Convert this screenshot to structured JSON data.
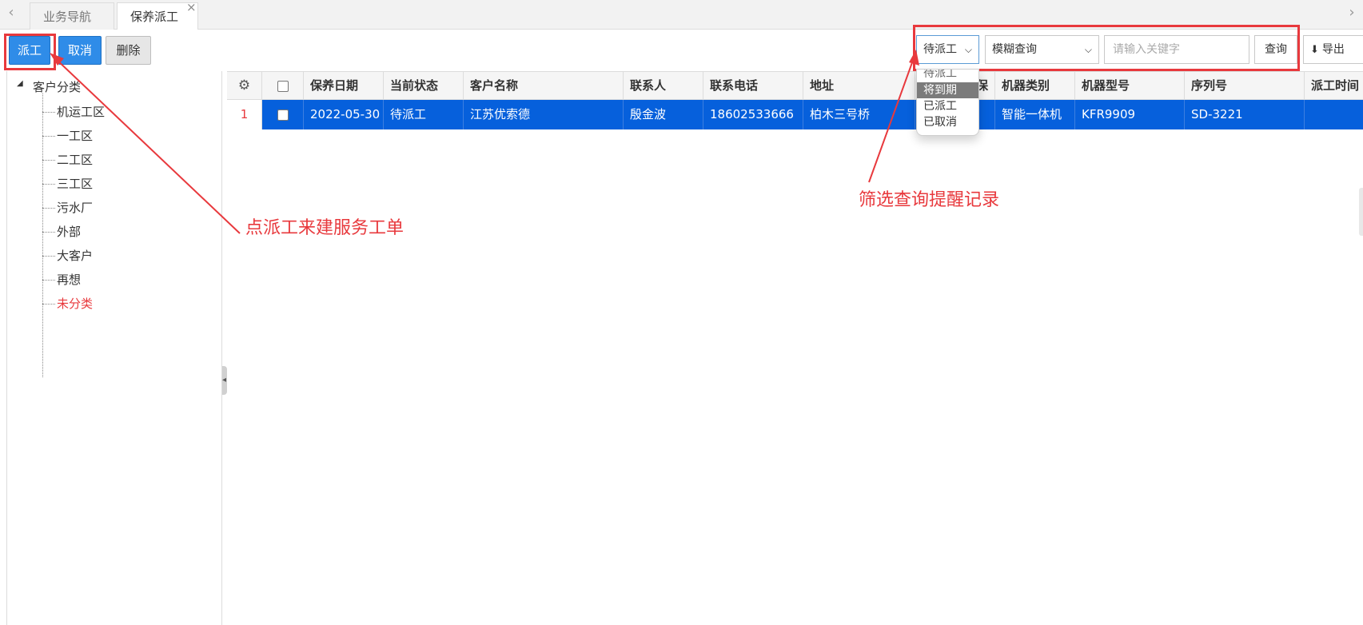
{
  "tabs": {
    "prev_icon": "‹",
    "next_icon": "›",
    "items": [
      {
        "label": "业务导航"
      },
      {
        "label": "保养派工"
      }
    ],
    "close_icon": "×"
  },
  "toolbar": {
    "dispatch_label": "派工",
    "cancel_label": "取消",
    "delete_label": "删除",
    "accent_color": "#2f8ce8"
  },
  "filters": {
    "status_selected": "待派工",
    "status_options": [
      "待派工",
      "将到期",
      "已派工",
      "已取消"
    ],
    "status_highlighted": "将到期",
    "mode_selected": "模糊查询",
    "keyword_placeholder": "请输入关键字",
    "query_label": "查询",
    "export_label": "导出",
    "chevron_icon": "chevron-down-icon",
    "export_icon": "download-icon"
  },
  "sidebar": {
    "root": "客户分类",
    "items": [
      {
        "label": "机运工区"
      },
      {
        "label": "一工区"
      },
      {
        "label": "二工区"
      },
      {
        "label": "三工区"
      },
      {
        "label": "污水厂"
      },
      {
        "label": "外部"
      },
      {
        "label": "大客户"
      },
      {
        "label": "再想"
      },
      {
        "label": "未分类"
      }
    ],
    "highlight_color": "#e8393d"
  },
  "grid": {
    "columns": [
      "保养日期",
      "当前状态",
      "客户名称",
      "联系人",
      "联系电话",
      "地址",
      "保",
      "机器类别",
      "机器型号",
      "序列号",
      "派工时间"
    ],
    "rows": [
      {
        "index": "1",
        "date": "2022-05-30",
        "status": "待派工",
        "customer": "江苏优索德",
        "contact": "殷金波",
        "phone": "18602533666",
        "address": "柏木三号桥",
        "category": "智能一体机",
        "model": "KFR9909",
        "serial": "SD-3221",
        "dispatch_time": ""
      }
    ],
    "selected_row_color": "#0660dc"
  },
  "annotations": {
    "dispatch_note": "点派工来建服务工单",
    "filter_note": "筛选查询提醒记录",
    "color": "#e8393d"
  }
}
